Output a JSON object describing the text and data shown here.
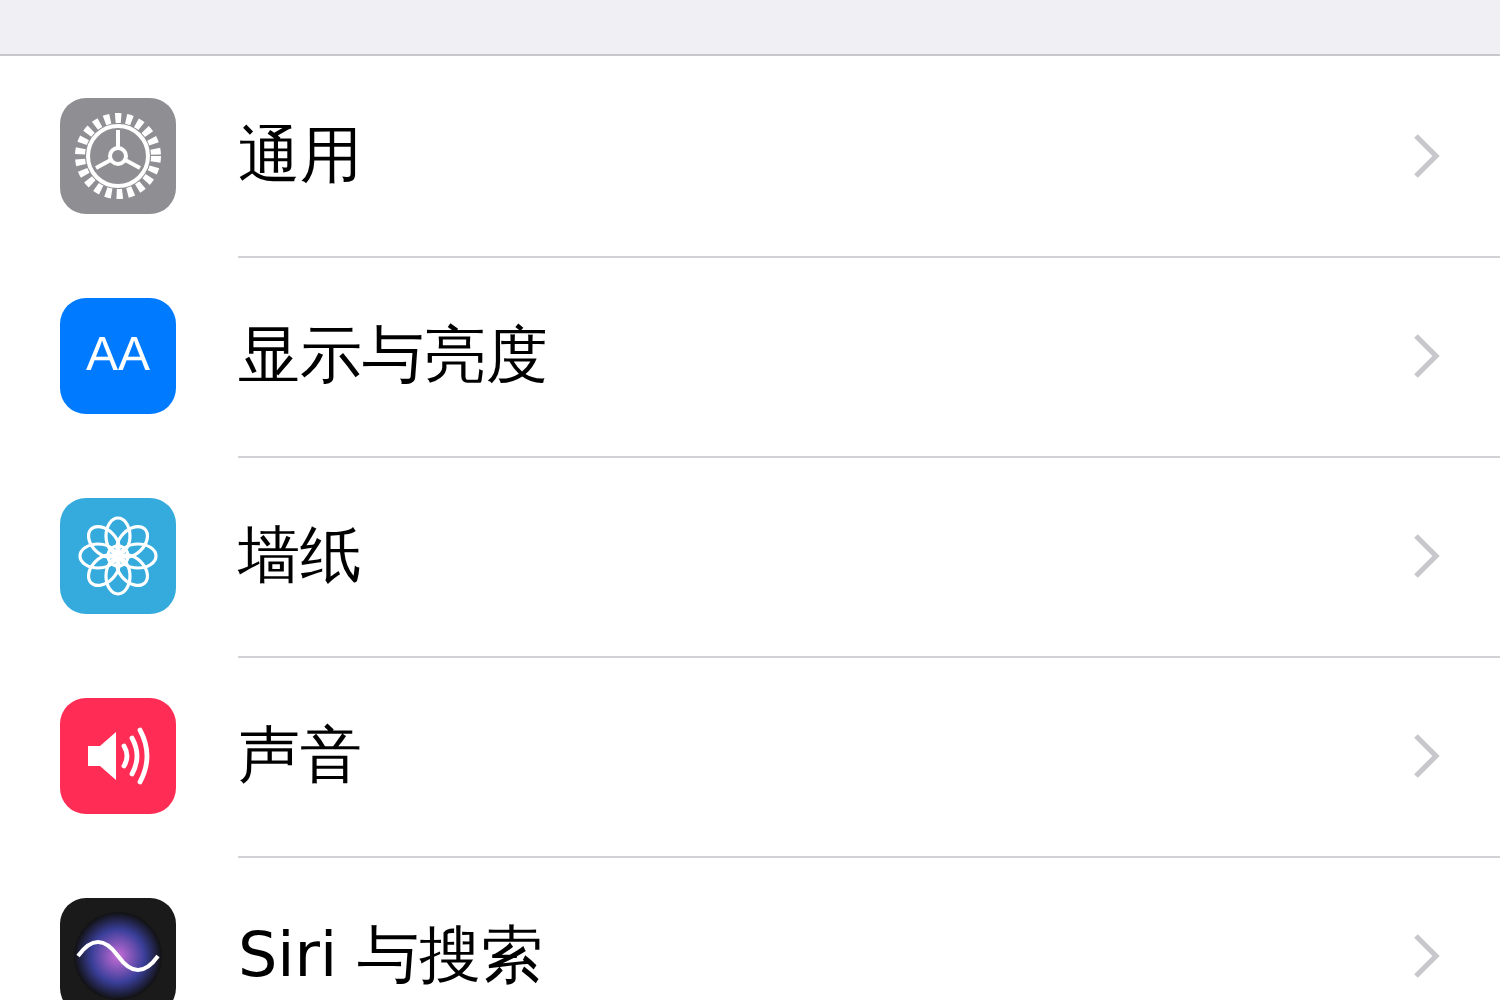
{
  "settings_list": {
    "items": [
      {
        "kind": "general",
        "label": "通用"
      },
      {
        "kind": "display",
        "label": "显示与亮度",
        "icon_text": "AA"
      },
      {
        "kind": "wallpaper",
        "label": "墙纸"
      },
      {
        "kind": "sounds",
        "label": "声音"
      },
      {
        "kind": "siri",
        "label": "Siri 与搜索"
      }
    ]
  }
}
